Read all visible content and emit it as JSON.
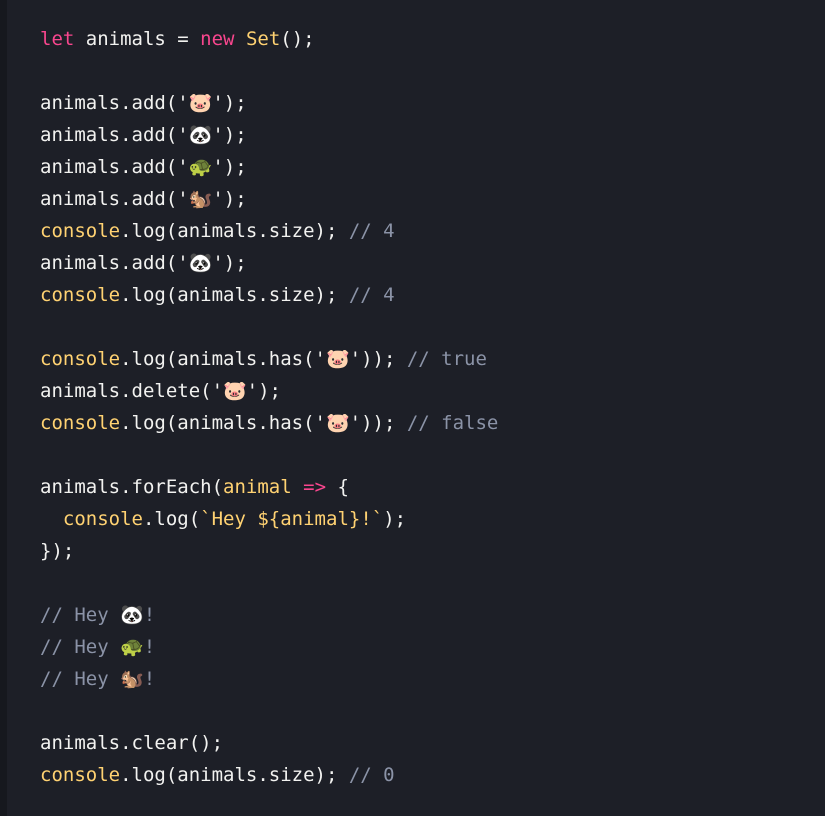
{
  "colors": {
    "background": "#1d1f27",
    "default": "#f2f2f0",
    "keyword": "#f9468e",
    "type": "#ffd272",
    "builtin": "#ffd272",
    "param": "#ffd272",
    "string": "#ffd272",
    "comment": "#8b93a7"
  },
  "code_lines": [
    [
      [
        "keyword",
        "let"
      ],
      [
        "default",
        " animals = "
      ],
      [
        "keyword",
        "new"
      ],
      [
        "default",
        " "
      ],
      [
        "type",
        "Set"
      ],
      [
        "default",
        "();"
      ]
    ],
    [],
    [
      [
        "default",
        "animals.add('🐷');"
      ]
    ],
    [
      [
        "default",
        "animals.add('🐼');"
      ]
    ],
    [
      [
        "default",
        "animals.add('🐢');"
      ]
    ],
    [
      [
        "default",
        "animals.add('🐿️');"
      ]
    ],
    [
      [
        "builtin",
        "console"
      ],
      [
        "default",
        ".log(animals.size); "
      ],
      [
        "comment",
        "// 4"
      ]
    ],
    [
      [
        "default",
        "animals.add('🐼');"
      ]
    ],
    [
      [
        "builtin",
        "console"
      ],
      [
        "default",
        ".log(animals.size); "
      ],
      [
        "comment",
        "// 4"
      ]
    ],
    [],
    [
      [
        "builtin",
        "console"
      ],
      [
        "default",
        ".log(animals.has('🐷')); "
      ],
      [
        "comment",
        "// true"
      ]
    ],
    [
      [
        "default",
        "animals.delete('🐷');"
      ]
    ],
    [
      [
        "builtin",
        "console"
      ],
      [
        "default",
        ".log(animals.has('🐷')); "
      ],
      [
        "comment",
        "// false"
      ]
    ],
    [],
    [
      [
        "default",
        "animals.forEach("
      ],
      [
        "param",
        "animal"
      ],
      [
        "default",
        " "
      ],
      [
        "keyword",
        "=>"
      ],
      [
        "default",
        " {"
      ]
    ],
    [
      [
        "default",
        "  "
      ],
      [
        "builtin",
        "console"
      ],
      [
        "default",
        ".log("
      ],
      [
        "string",
        "`Hey ${animal}!`"
      ],
      [
        "default",
        ");"
      ]
    ],
    [
      [
        "default",
        "});"
      ]
    ],
    [],
    [
      [
        "comment",
        "// Hey 🐼!"
      ]
    ],
    [
      [
        "comment",
        "// Hey 🐢!"
      ]
    ],
    [
      [
        "comment",
        "// Hey 🐿️!"
      ]
    ],
    [],
    [
      [
        "default",
        "animals.clear();"
      ]
    ],
    [
      [
        "builtin",
        "console"
      ],
      [
        "default",
        ".log(animals.size); "
      ],
      [
        "comment",
        "// 0"
      ]
    ]
  ]
}
